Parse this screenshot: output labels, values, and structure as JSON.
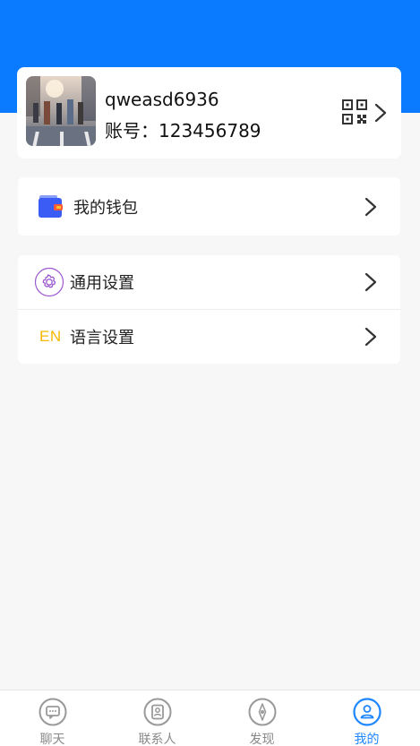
{
  "profile": {
    "username": "qweasd6936",
    "account": "账号：123456789"
  },
  "menu": {
    "wallet_label": "我的钱包",
    "general_settings_label": "通用设置",
    "language_settings_label": "语言设置",
    "language_icon_text": "EN"
  },
  "tabs": [
    {
      "label": "聊天",
      "icon": "chat-icon"
    },
    {
      "label": "联系人",
      "icon": "contacts-icon"
    },
    {
      "label": "发现",
      "icon": "compass-icon"
    },
    {
      "label": "我的",
      "icon": "user-icon"
    }
  ],
  "colors": {
    "header": "#0a7aff",
    "active_tab": "#1e86ff",
    "wallet_icon": "#3b5cf5",
    "settings_icon": "#9b59d0",
    "language_icon": "#f5b800"
  }
}
